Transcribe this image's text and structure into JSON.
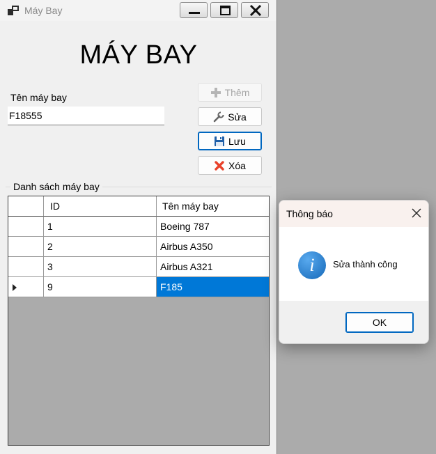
{
  "window": {
    "title": "Máy Bay",
    "heading": "MÁY BAY"
  },
  "form": {
    "name_label": "Tên máy bay",
    "name_value": "F18555"
  },
  "buttons": {
    "add_label": "Thêm",
    "edit_label": "Sửa",
    "save_label": "Lưu",
    "delete_label": "Xóa"
  },
  "list": {
    "group_label": "Danh sách máy bay",
    "columns": [
      "ID",
      "Tên máy bay"
    ],
    "rows": [
      {
        "id": "1",
        "name": "Boeing 787"
      },
      {
        "id": "2",
        "name": "Airbus A350"
      },
      {
        "id": "3",
        "name": "Airbus A321"
      },
      {
        "id": "9",
        "name": "F185"
      }
    ],
    "selected_row": 3
  },
  "dialog": {
    "title": "Thông báo",
    "message": "Sửa thành công",
    "ok_label": "OK",
    "icon": "info-icon"
  },
  "colors": {
    "selection": "#0078d7",
    "focus_border": "#0067c0",
    "delete_icon": "#e8412a",
    "save_icon": "#1f5fa8"
  }
}
